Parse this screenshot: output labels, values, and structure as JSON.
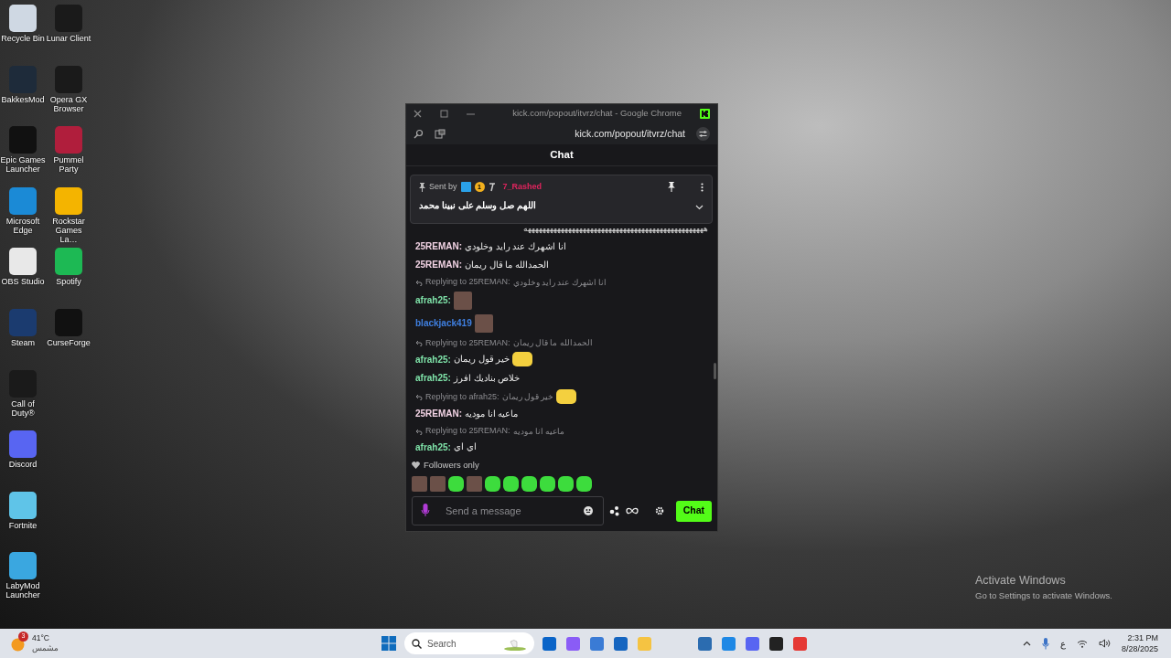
{
  "desktop_icons": [
    {
      "label": "Recycle Bin"
    },
    {
      "label": "BakkesMod"
    },
    {
      "label": "Epic Games Launcher"
    },
    {
      "label": "Microsoft Edge"
    },
    {
      "label": "OBS Studio"
    },
    {
      "label": "Steam"
    },
    {
      "label": "Call of Duty®"
    },
    {
      "label": "Discord"
    },
    {
      "label": "Fortnite"
    },
    {
      "label": "LabyMod Launcher"
    },
    {
      "label": "Lunar Client"
    },
    {
      "label": "Opera GX Browser"
    },
    {
      "label": "Pummel Party"
    },
    {
      "label": "Rockstar Games La…"
    },
    {
      "label": "Spotify"
    },
    {
      "label": "CurseForge"
    }
  ],
  "window": {
    "title": "kick.com/popout/itvrz/chat - Google Chrome",
    "url": "kick.com/popout/itvrz/chat"
  },
  "chat": {
    "header": "Chat",
    "pinned": {
      "sent_by": "Sent by",
      "badge": "1",
      "username": "7_Rashed",
      "text": "اللهم صل وسلم على نبينا محمد"
    },
    "messages": [
      {
        "kind": "continuation",
        "text": "هههههههههههههههههههههههههههههههههههههههههههههههههه"
      },
      {
        "kind": "message",
        "username": "25REMAN:",
        "color": "#f2d3e4",
        "text": "انا اشهرك عند رايد وخلودي"
      },
      {
        "kind": "message",
        "username": "25REMAN:",
        "color": "#f2d3e4",
        "text": "الحمدالله ما قال ريمان"
      },
      {
        "kind": "message",
        "reply_to": "Replying to 25REMAN:",
        "reply_text": "انا اشهرك عند رايد وخلودي",
        "username": "afrah25:",
        "color": "#7fe3a9",
        "emote": {
          "kind": "photo"
        }
      },
      {
        "kind": "message",
        "username": "blackjack419",
        "color": "#3f7fe0",
        "emote": {
          "kind": "photo"
        }
      },
      {
        "kind": "message",
        "reply_to": "Replying to 25REMAN:",
        "reply_text": "الحمدالله ما قال ريمان",
        "username": "afrah25:",
        "color": "#7fe3a9",
        "text": "خير قول ريمان",
        "emote": {
          "kind": "yellow"
        }
      },
      {
        "kind": "message",
        "username": "afrah25:",
        "color": "#7fe3a9",
        "text": "خلاص بناديك افرز"
      },
      {
        "kind": "message",
        "reply_to": "Replying to afrah25:",
        "reply_text": "خير قول ريمان",
        "reply_emote": {
          "kind": "yellow"
        },
        "username": "25REMAN:",
        "color": "#f2d3e4",
        "text": "ماعيه انا موديه"
      },
      {
        "kind": "message",
        "reply_to": "Replying to 25REMAN:",
        "reply_text": "ماعيه انا موديه",
        "username": "afrah25:",
        "color": "#7fe3a9",
        "text": "اي اي"
      }
    ],
    "followers_notice": "Followers only",
    "emotes": [
      {
        "kind": "photo"
      },
      {
        "kind": "photo"
      },
      {
        "kind": "green"
      },
      {
        "kind": "photo"
      },
      {
        "kind": "green"
      },
      {
        "kind": "green"
      },
      {
        "kind": "green"
      },
      {
        "kind": "green"
      },
      {
        "kind": "green"
      },
      {
        "kind": "green"
      }
    ],
    "input": {
      "placeholder": "Send a message"
    },
    "send_button": "Chat"
  },
  "watermark": {
    "title": "Activate Windows",
    "subtitle": "Go to Settings to activate Windows."
  },
  "taskbar": {
    "weather_badge": "3",
    "temperature": "41°C",
    "condition": "مشمس",
    "search_placeholder": "Search",
    "language": "ع",
    "time": "2:31 PM",
    "date": "8/28/2025"
  }
}
